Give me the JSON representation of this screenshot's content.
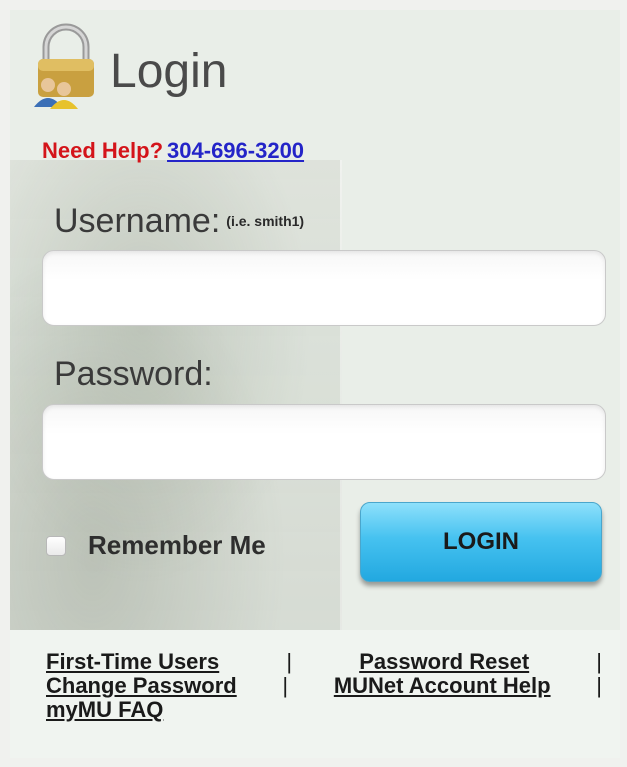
{
  "header": {
    "title": "Login",
    "icon": "lock-users-icon"
  },
  "help": {
    "label": "Need Help?",
    "phone": "304-696-3200"
  },
  "username": {
    "label": "Username:",
    "hint": "(i.e. smith1)",
    "value": ""
  },
  "password": {
    "label": "Password:",
    "value": ""
  },
  "remember": {
    "label": "Remember Me",
    "checked": false
  },
  "login_button": {
    "label": "LOGIN"
  },
  "links": {
    "first_time_users": "First-Time Users",
    "password_reset": "Password Reset",
    "change_password": "Change Password",
    "munet_account_help": "MUNet Account Help",
    "mymu_faq": "myMU FAQ",
    "separator": "|"
  },
  "colors": {
    "help_red": "#d4141a",
    "phone_blue": "#2424c8",
    "button_blue": "#46c2f0"
  }
}
